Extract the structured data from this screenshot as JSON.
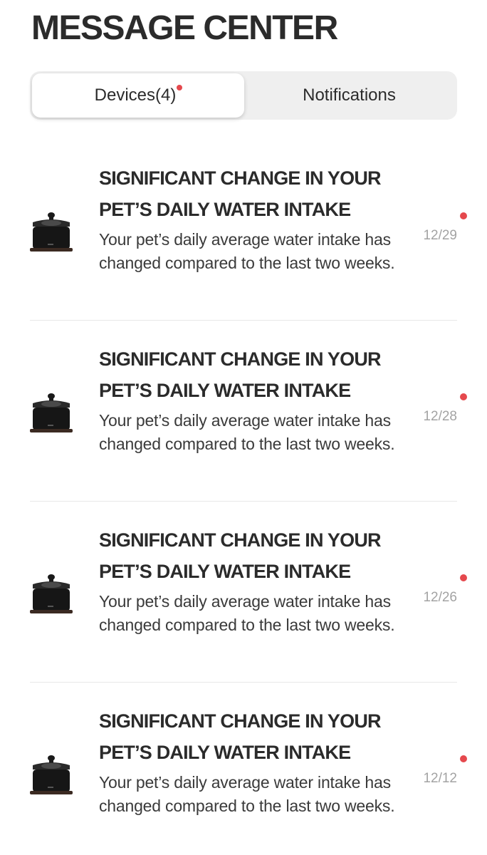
{
  "header": {
    "title": "MESSAGE CENTER"
  },
  "tabs": [
    {
      "label": "Devices(4)",
      "active": true,
      "has_unread_dot": true
    },
    {
      "label": "Notifications",
      "active": false,
      "has_unread_dot": false
    }
  ],
  "colors": {
    "unread_dot": "#e5484d",
    "tab_background": "#efefef",
    "date_text": "#a3a3a3"
  },
  "messages": [
    {
      "icon": "water-fountain-device-icon",
      "title": "SIGNIFICANT CHANGE IN YOUR PET’S DAILY WATER INTAKE",
      "body": "Your pet’s daily average water intake has changed compared to the last two weeks.",
      "date": "12/29",
      "unread": true
    },
    {
      "icon": "water-fountain-device-icon",
      "title": "SIGNIFICANT CHANGE IN YOUR PET’S DAILY WATER INTAKE",
      "body": "Your pet’s daily average water intake has changed compared to the last two weeks.",
      "date": "12/28",
      "unread": true
    },
    {
      "icon": "water-fountain-device-icon",
      "title": "SIGNIFICANT CHANGE IN YOUR PET’S DAILY WATER INTAKE",
      "body": "Your pet’s daily average water intake has changed compared to the last two weeks.",
      "date": "12/26",
      "unread": true
    },
    {
      "icon": "water-fountain-device-icon",
      "title": "SIGNIFICANT CHANGE IN YOUR PET’S DAILY WATER INTAKE",
      "body": "Your pet’s daily average water intake has changed compared to the last two weeks.",
      "date": "12/12",
      "unread": true
    }
  ]
}
